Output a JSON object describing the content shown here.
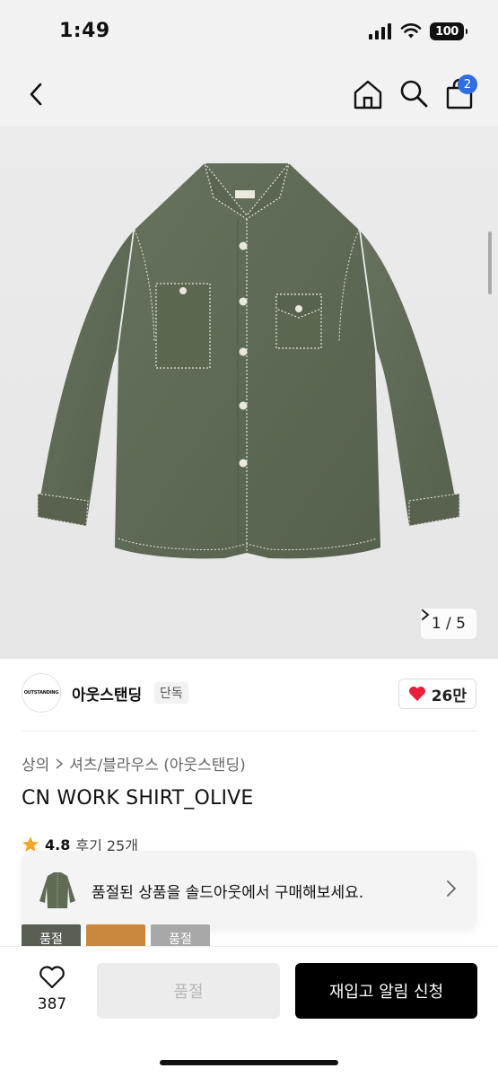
{
  "status_bar": {
    "time": "1:49",
    "battery": "100"
  },
  "nav": {
    "bag_count": "2"
  },
  "gallery": {
    "pager": "1 / 5"
  },
  "brand": {
    "logo_text": "OUTSTANDING",
    "name": "아웃스탠딩",
    "tag": "단독",
    "likes": "26만"
  },
  "product": {
    "breadcrumb": [
      "상의",
      "셔츠/블라우스 (아웃스탠딩)"
    ],
    "title": "CN WORK SHIRT_OLIVE",
    "rating": "4.8",
    "reviews": "후기 25개"
  },
  "soldout_banner": {
    "text": "품절된 상품을 솔드아웃에서 구매해보세요."
  },
  "thumbnails": [
    {
      "label": "품절",
      "color": "#5a5f55"
    },
    {
      "label": "",
      "color": "#c9883d"
    },
    {
      "label": "품절",
      "color": "#a8a8a8"
    }
  ],
  "bottom_bar": {
    "wish_count": "387",
    "soldout_label": "품절",
    "restock_label": "재입고 알림 신청"
  },
  "colors": {
    "accent_badge": "#2f6de1",
    "heart": "#e8203a",
    "shirt": "#5f6b55"
  }
}
